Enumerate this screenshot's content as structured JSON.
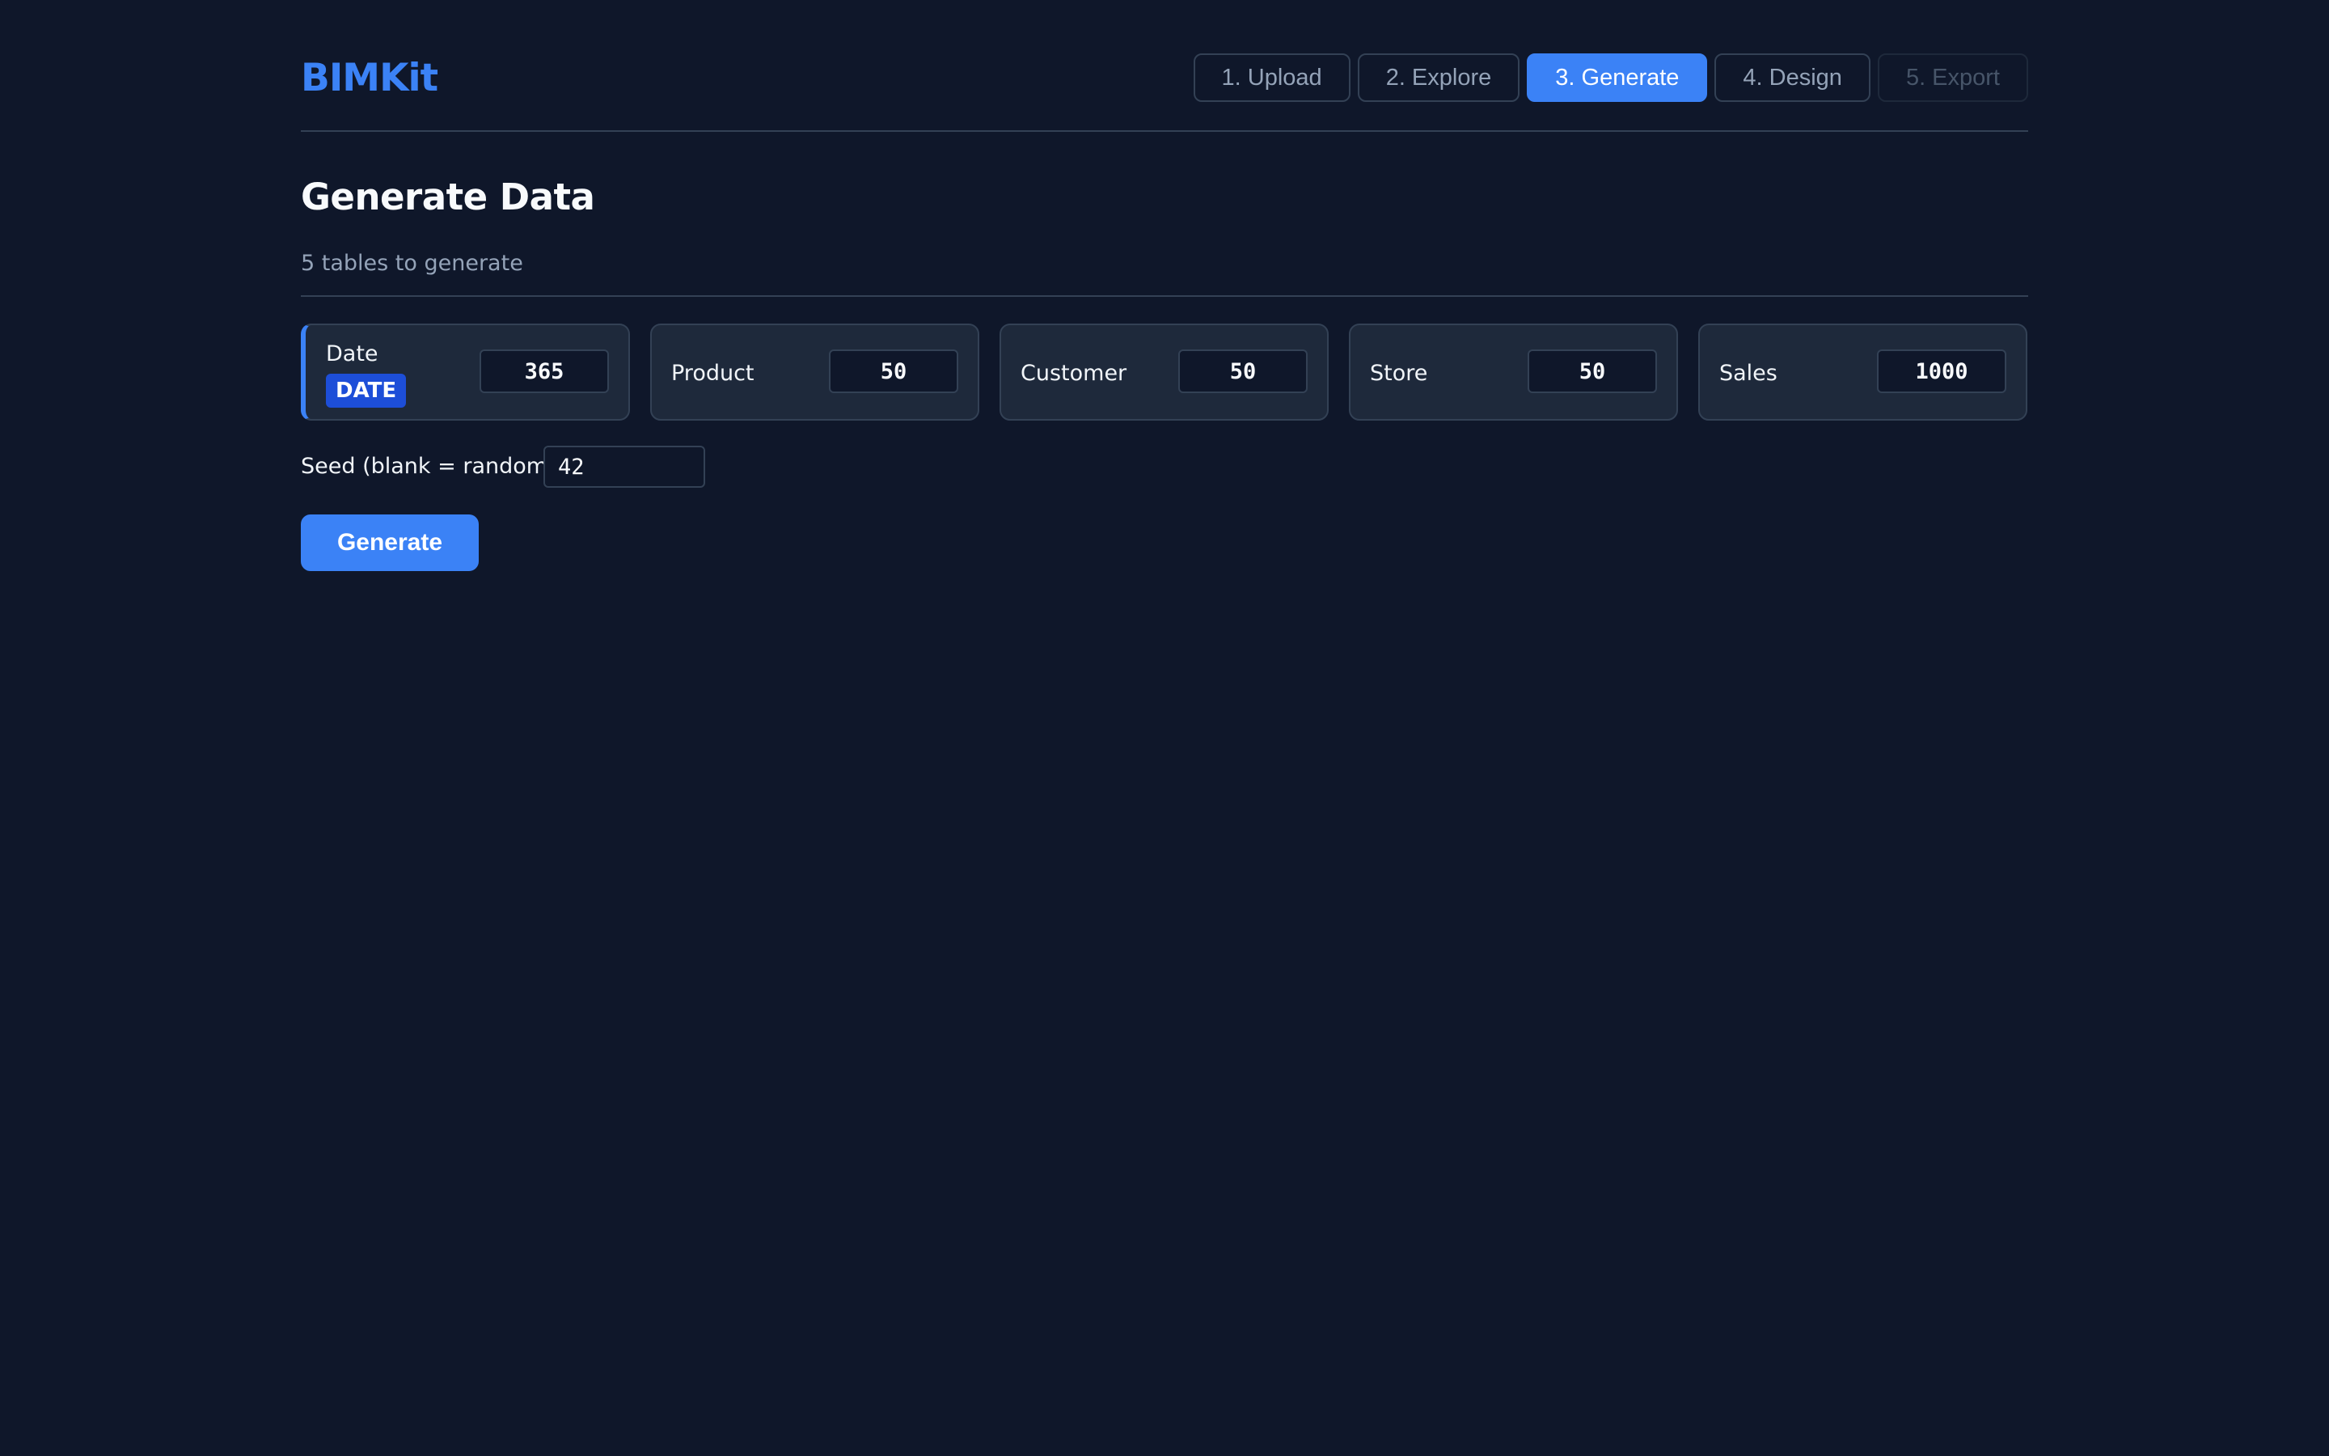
{
  "app": {
    "brand": "BIMKit"
  },
  "steps": [
    {
      "label": "1. Upload",
      "state": "default"
    },
    {
      "label": "2. Explore",
      "state": "default"
    },
    {
      "label": "3. Generate",
      "state": "active"
    },
    {
      "label": "4. Design",
      "state": "default"
    },
    {
      "label": "5. Export",
      "state": "disabled"
    }
  ],
  "page": {
    "title": "Generate Data",
    "subtitle": "5 tables to generate"
  },
  "tables": [
    {
      "name": "Date",
      "badge": "DATE",
      "rows": "365"
    },
    {
      "name": "Product",
      "rows": "50"
    },
    {
      "name": "Customer",
      "rows": "50"
    },
    {
      "name": "Store",
      "rows": "50"
    },
    {
      "name": "Sales",
      "rows": "1000"
    }
  ],
  "seed": {
    "label": "Seed (blank = random)",
    "value": "42"
  },
  "actions": {
    "generate_label": "Generate"
  },
  "colors": {
    "background": "#0f172a",
    "card": "#1e293b",
    "accent": "#3b82f6",
    "badge": "#1d4ed8",
    "border": "#334155",
    "muted_text": "#94a3b8"
  }
}
